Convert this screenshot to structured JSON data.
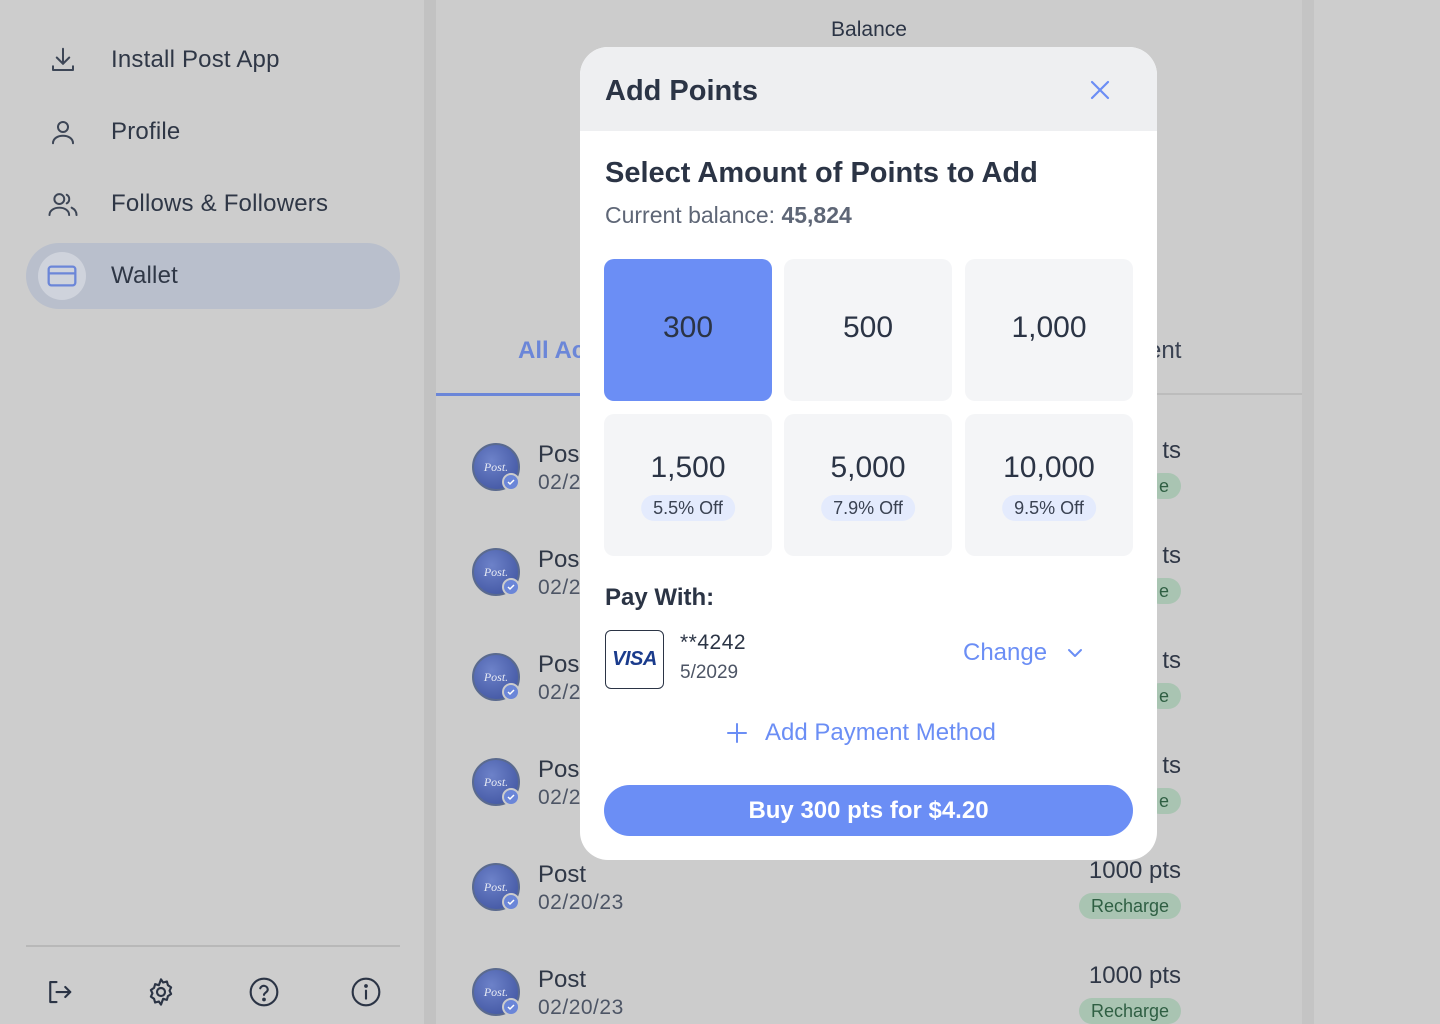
{
  "sidebar": {
    "items": [
      {
        "label": "Install Post App",
        "icon": "download-icon"
      },
      {
        "label": "Profile",
        "icon": "user-icon"
      },
      {
        "label": "Follows & Followers",
        "icon": "users-icon"
      },
      {
        "label": "Wallet",
        "icon": "credit-card-icon",
        "active": true
      }
    ],
    "footer_icons": [
      "logout-icon",
      "gear-icon",
      "help-icon",
      "info-icon"
    ]
  },
  "main": {
    "balance_label": "Balance",
    "tabs": [
      {
        "label": "All Ac",
        "active": true
      },
      {
        "label": "ent"
      }
    ],
    "transactions": [
      {
        "avatar": "Post.",
        "title": "Pos",
        "date": "02/2",
        "amount": "ts",
        "badge": "e"
      },
      {
        "avatar": "Post.",
        "title": "Pos",
        "date": "02/2",
        "amount": "ts",
        "badge": "e"
      },
      {
        "avatar": "Post.",
        "title": "Pos",
        "date": "02/2",
        "amount": "ts",
        "badge": "e"
      },
      {
        "avatar": "Post.",
        "title": "Pos",
        "date": "02/2",
        "amount": "ts",
        "badge": "e"
      },
      {
        "avatar": "Post.",
        "title": "Post",
        "date": "02/20/23",
        "amount": "1000 pts",
        "badge": "Recharge"
      },
      {
        "avatar": "Post.",
        "title": "Post",
        "date": "02/20/23",
        "amount": "1000 pts",
        "badge": "Recharge"
      }
    ]
  },
  "modal": {
    "title": "Add Points",
    "section_title": "Select Amount of Points to Add",
    "balance_prefix": "Current balance:",
    "balance_value": "45,824",
    "options": [
      {
        "amount": "300",
        "discount": "",
        "selected": true
      },
      {
        "amount": "500",
        "discount": ""
      },
      {
        "amount": "1,000",
        "discount": ""
      },
      {
        "amount": "1,500",
        "discount": "5.5% Off"
      },
      {
        "amount": "5,000",
        "discount": "7.9% Off"
      },
      {
        "amount": "10,000",
        "discount": "9.5% Off"
      }
    ],
    "pay_with_label": "Pay With:",
    "card": {
      "brand": "VISA",
      "number": "**4242",
      "expiry": "5/2029"
    },
    "change_label": "Change",
    "add_payment_label": "Add Payment Method",
    "buy_label": "Buy 300 pts for $4.20"
  },
  "colors": {
    "accent": "#6b8ef5",
    "overlay_bg": "#cdcdcd",
    "badge_green": "#a9c4b2"
  }
}
